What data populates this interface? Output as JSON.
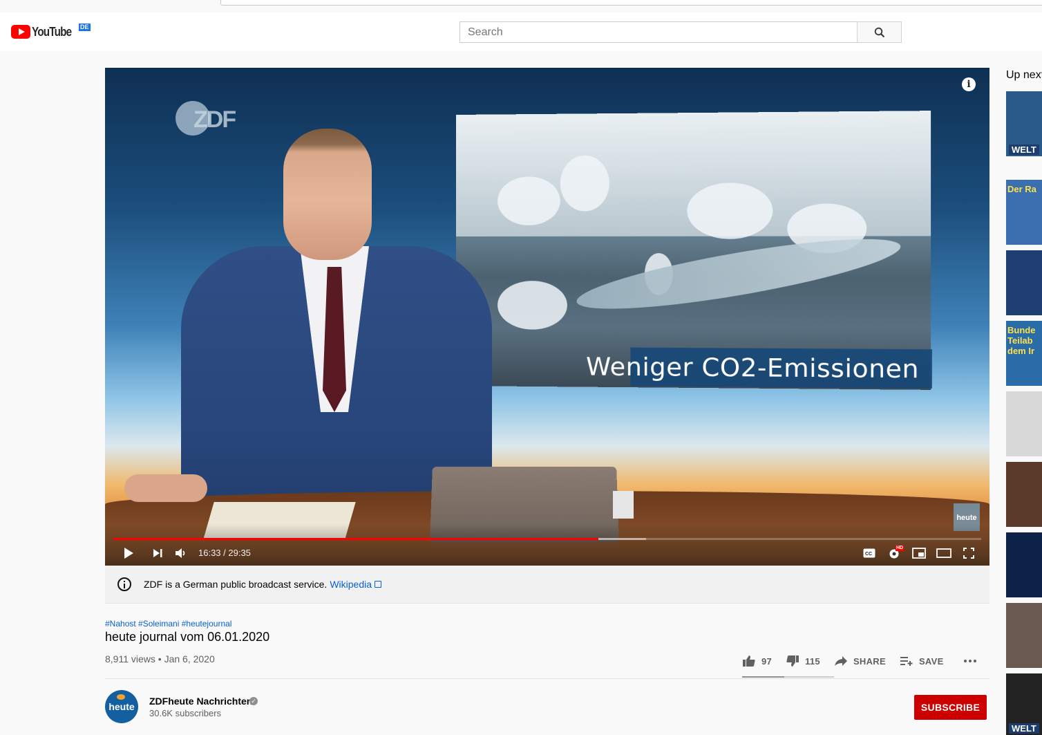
{
  "masthead": {
    "logo_text": "YouTube",
    "country_code": "DE",
    "search_placeholder": "Search"
  },
  "player": {
    "overlay_caption": "Weniger CO2-Emissionen",
    "studio_logo": "ZDF",
    "corner_bug": "heute",
    "current_time": "16:33",
    "duration": "29:35",
    "time_display": "16:33 / 29:35",
    "played_fraction": 0.559,
    "buffered_fraction": 0.614,
    "hd_badge": "HD",
    "icons": {
      "play": "play-icon",
      "next": "next-icon",
      "volume": "volume-icon",
      "captions": "cc-icon",
      "settings": "settings-icon",
      "miniplayer": "miniplayer-icon",
      "theater": "theater-icon",
      "fullscreen": "fullscreen-icon",
      "info": "info-icon"
    },
    "accent_color": "#ff0000"
  },
  "info_panel": {
    "text": "ZDF is a German public broadcast service.",
    "link_text": "Wikipedia"
  },
  "video": {
    "hashtags": "#Nahost #Soleimani #heutejournal",
    "title": "heute journal vom 06.01.2020",
    "views_date": "8,911 views • Jan 6, 2020",
    "like_count": "97",
    "dislike_count": "115",
    "share_label": "SHARE",
    "save_label": "SAVE"
  },
  "channel": {
    "name": "ZDFheute Nachrichten",
    "subscribers": "30.6K subscribers",
    "avatar_text": "heute",
    "subscribe_label": "SUBSCRIBE"
  },
  "sidebar": {
    "up_next_label": "Up next",
    "thumbnails": [
      {
        "label": "WELT",
        "bg": "#2a5a8a"
      },
      {
        "label": "Der Ra",
        "bg": "#3b6fb0"
      },
      {
        "label": "",
        "bg": "#1f3f73"
      },
      {
        "label": "Bunde Teilab dem Ir",
        "bg": "#2a6ca8"
      },
      {
        "label": "",
        "bg": "#d8d8d8"
      },
      {
        "label": "",
        "bg": "#5b3a2c"
      },
      {
        "label": "",
        "bg": "#0e2148"
      },
      {
        "label": "",
        "bg": "#6b5a52"
      },
      {
        "label": "WELT",
        "bg": "#222"
      }
    ]
  }
}
